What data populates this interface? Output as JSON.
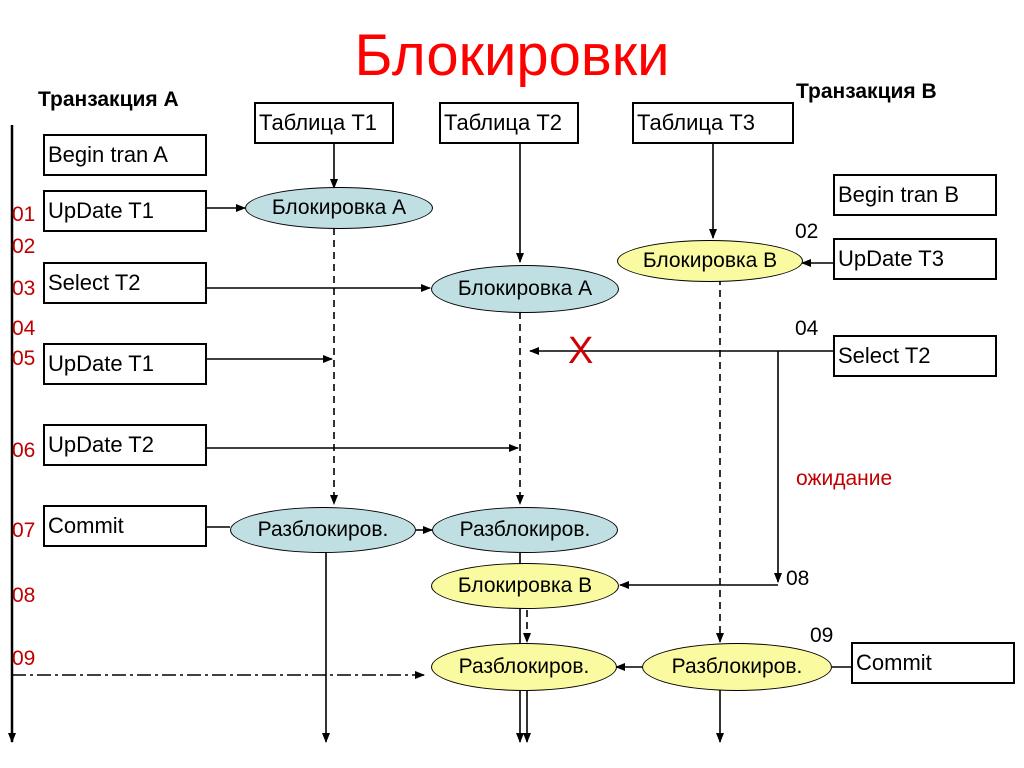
{
  "title": "Блокировки",
  "transactions": {
    "a": {
      "label": "Транзакция A"
    },
    "b": {
      "label": "Транзакция B"
    }
  },
  "tables": [
    {
      "id": "t1",
      "label": "Таблица T1"
    },
    {
      "id": "t2",
      "label": "Таблица T2"
    },
    {
      "id": "t3",
      "label": "Таблица T3"
    }
  ],
  "tran_a_steps": [
    {
      "step": "",
      "label": "Begin tran A"
    },
    {
      "step": "01",
      "label": "UpDate T1"
    },
    {
      "step": "03",
      "label": "Select T2"
    },
    {
      "step": "05",
      "label": "UpDate T1"
    },
    {
      "step": "06",
      "label": "UpDate T2"
    },
    {
      "step": "07",
      "label": "Commit"
    }
  ],
  "tran_a_extra_step_numbers": [
    "02",
    "04",
    "08",
    "09"
  ],
  "tran_b_steps": [
    {
      "step": "",
      "label": "Begin tran B"
    },
    {
      "step": "02",
      "label": "UpDate T3"
    },
    {
      "step": "04",
      "label": "Select T2"
    },
    {
      "step": "09",
      "label": "Commit"
    }
  ],
  "tran_b_extra_step_numbers": [
    "08"
  ],
  "locks": {
    "lock_a_t1": "Блокировка A",
    "lock_a_t2": "Блокировка A",
    "lock_b_t3": "Блокировка B",
    "unlock_a_t1": "Разблокиров.",
    "unlock_a_t2": "Разблокиров.",
    "lock_b_t2": "Блокировка B",
    "unlock_b_t2": "Разблокиров.",
    "unlock_b_t3": "Разблокиров."
  },
  "annotations": {
    "blocked_mark": "X",
    "waiting": "ожидание"
  },
  "colors": {
    "title": "#ff0000",
    "step_numbers_a": "#c00000",
    "lock_a_fill": "#bfdfe3",
    "lock_b_fill": "#fafaa0",
    "waiting_text": "#c00000"
  }
}
